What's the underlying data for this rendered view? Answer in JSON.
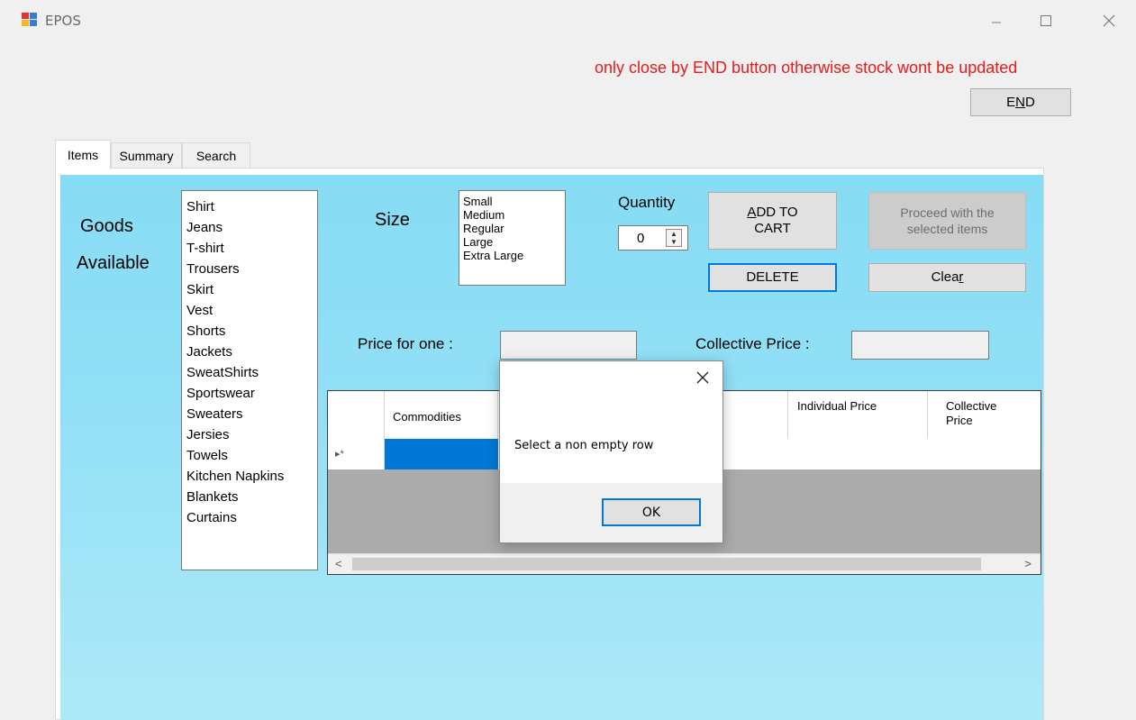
{
  "window": {
    "title": "EPOS"
  },
  "warning": "only close by END button otherwise stock wont be updated",
  "end_button": {
    "pre": "E",
    "key": "N",
    "post": "D"
  },
  "tabs": [
    "Items",
    "Summary",
    "Search"
  ],
  "goods": {
    "label_line1": "Goods",
    "label_line2": "Available",
    "items": [
      "Shirt",
      "Jeans",
      "T-shirt",
      "Trousers",
      "Skirt",
      "Vest",
      "Shorts",
      "Jackets",
      "SweatShirts",
      "Sportswear",
      "Sweaters",
      "Jersies",
      "Towels",
      "Kitchen Napkins",
      "Blankets",
      "Curtains"
    ]
  },
  "size": {
    "label": "Size",
    "options": [
      "Small",
      "Medium",
      "Regular",
      "Large",
      "Extra Large"
    ]
  },
  "quantity": {
    "label": "Quantity",
    "value": "0"
  },
  "buttons": {
    "add_key": "A",
    "add_rest_line1": "DD TO",
    "add_line2": "CART",
    "proceed": "Proceed with the selected items",
    "delete": "DELETE",
    "clear_pre": "Clea",
    "clear_key": "r"
  },
  "price_one_label": "Price for one :",
  "collective_price_label": "Collective Price :",
  "grid": {
    "columns": [
      "Commodities",
      "Individual Price",
      "Collective Price"
    ],
    "new_row_marker": "▸*"
  },
  "dialog": {
    "message": "Select a non empty row",
    "ok": "OK"
  },
  "colors": {
    "panel": "#86dcf4",
    "warning": "#e81b1b",
    "selection": "#0078d7"
  }
}
